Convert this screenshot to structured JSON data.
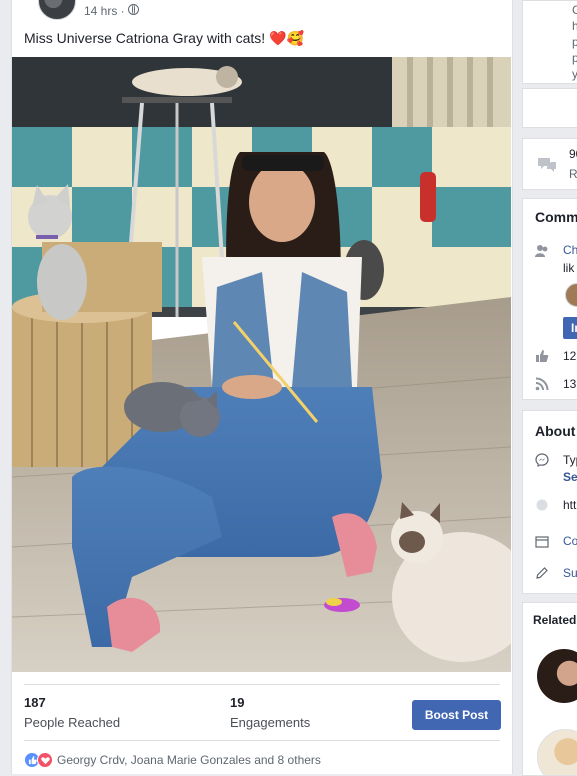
{
  "post": {
    "timestamp": "14 hrs · ",
    "text": "Miss Universe Catriona Gray with cats! ❤️🥰",
    "stats": [
      {
        "value": "187",
        "label": "People Reached"
      },
      {
        "value": "19",
        "label": "Engagements"
      }
    ],
    "boost_label": "Boost Post",
    "reactions_text": "Georgy Crdv, Joana Marie Gonzales and 8 others"
  },
  "sidebar": {
    "top_letters": [
      "G",
      "h",
      "p",
      "p",
      "y"
    ],
    "views_count": "90",
    "views_label": "R",
    "community": {
      "title": "Comm",
      "likes_line1": "Ch",
      "likes_line2": "lik",
      "invite_label": "In",
      "likes_count": "12",
      "follows_count": "13"
    },
    "about": {
      "title": "About",
      "type_label": "Typ",
      "type_link": "Se",
      "website": "htt",
      "category": "Co",
      "suggest": "Su"
    },
    "related_title": "Related"
  },
  "colors": {
    "brand_blue": "#4267b2",
    "link_blue": "#365899",
    "like_blue": "#5890ff",
    "love_red": "#f25268",
    "page_bg": "#e9ebee"
  }
}
